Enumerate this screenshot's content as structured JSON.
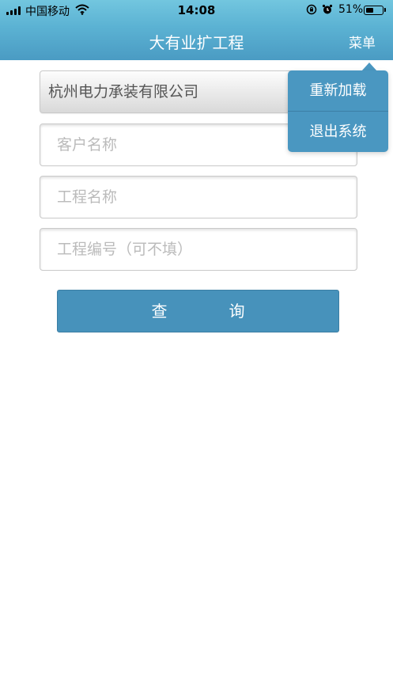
{
  "status_bar": {
    "carrier": "中国移动",
    "time": "14:08",
    "battery_percent": "51%",
    "battery_level": 0.51,
    "icons": [
      "signal-icon",
      "wifi-icon",
      "orientation-lock-icon",
      "alarm-icon",
      "battery-icon"
    ]
  },
  "header": {
    "title": "大有业扩工程",
    "menu_label": "菜单",
    "background_color": "#5bb2d3"
  },
  "form": {
    "company_select": {
      "value": "杭州电力承装有限公司"
    },
    "customer_name": {
      "placeholder": "客户名称"
    },
    "project_name": {
      "placeholder": "工程名称"
    },
    "project_number": {
      "placeholder": "工程编号（可不填）"
    },
    "query_button": "查询"
  },
  "menu_dropdown": {
    "items": [
      {
        "label": "重新加载"
      },
      {
        "label": "退出系统"
      }
    ],
    "background_color": "#4a97c1"
  },
  "colors": {
    "accent": "#4792bb"
  }
}
